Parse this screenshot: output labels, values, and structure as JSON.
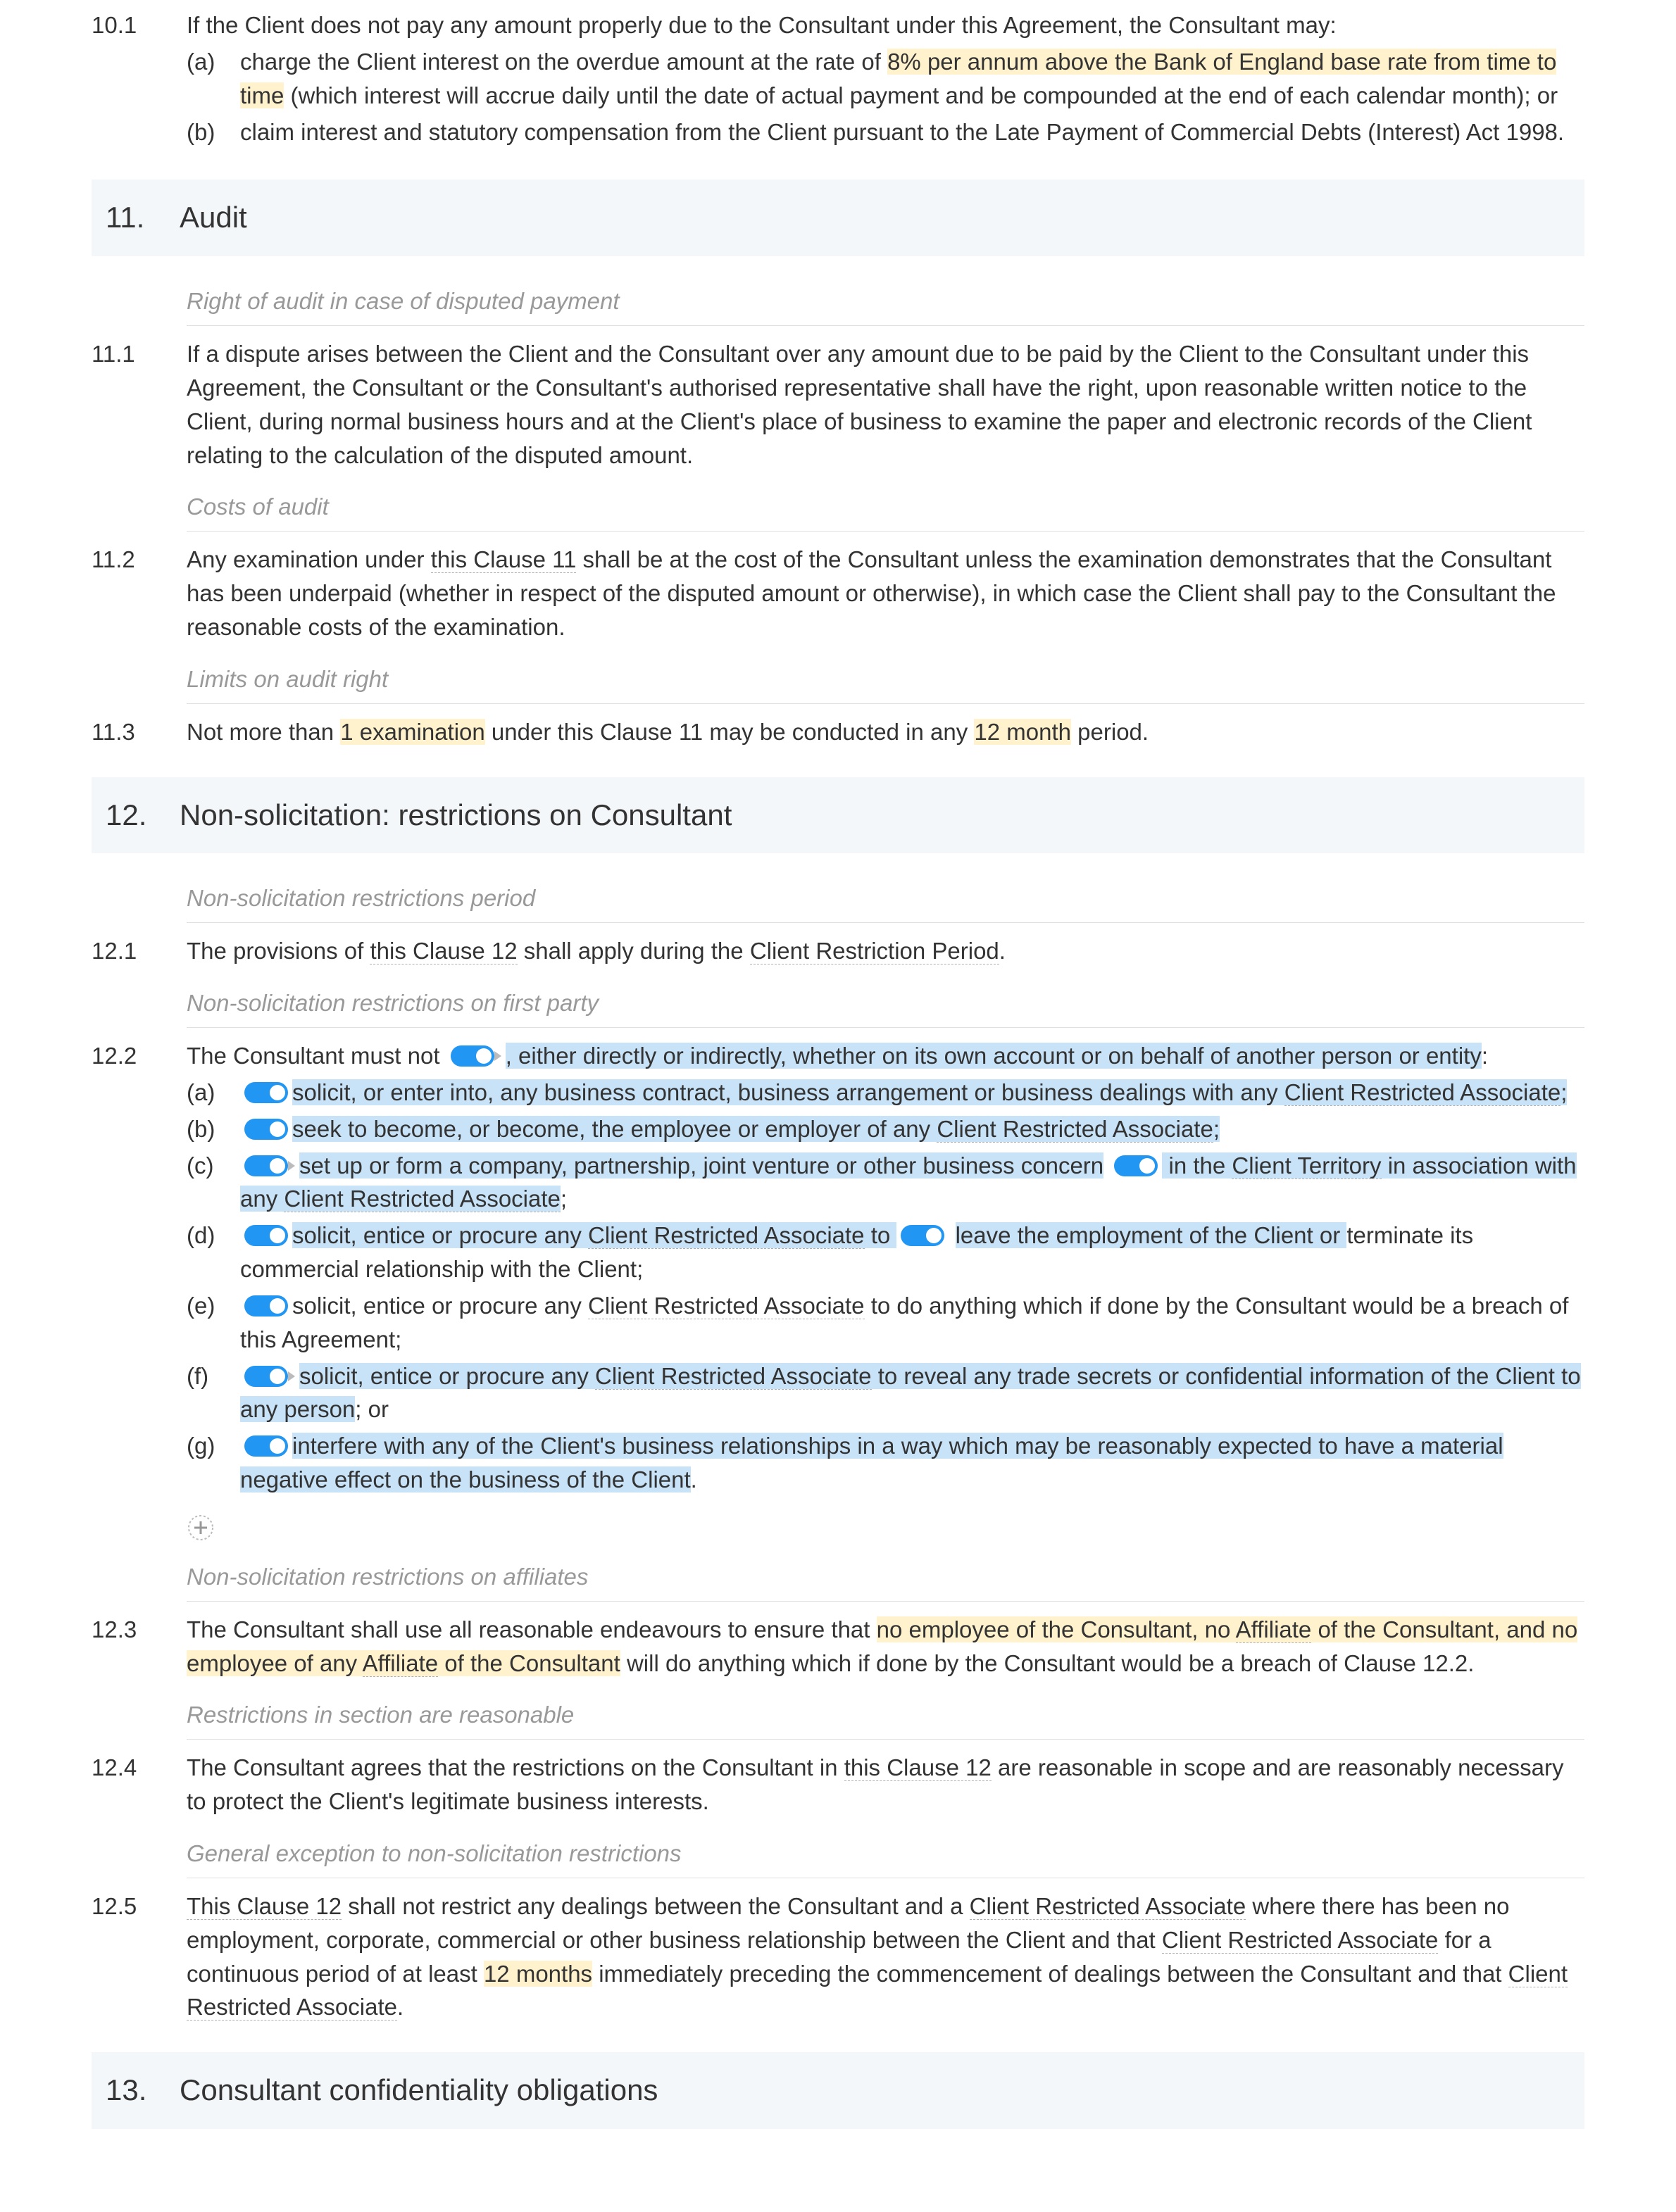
{
  "c10_1": {
    "num": "10.1",
    "text": "If the Client does not pay any amount properly due to the Consultant under this Agreement, the Consultant may:",
    "a_num": "(a)",
    "a_pre": "charge the Client interest on the overdue amount at the rate of ",
    "a_hl": "8% per annum above the Bank of England base rate from time to time",
    "a_post": " (which interest will accrue daily until the date of actual payment and be compounded at the end of each calendar month); or",
    "b_num": "(b)",
    "b_text": "claim interest and statutory compensation from the Client pursuant to the Late Payment of Commercial Debts (Interest) Act 1998."
  },
  "s11": {
    "num": "11.",
    "title": "Audit"
  },
  "sh_11a": "Right of audit in case of disputed payment",
  "c11_1": {
    "num": "11.1",
    "text": "If a dispute arises between the Client and the Consultant over any amount due to be paid by the Client to the Consultant under this Agreement, the Consultant or the Consultant's authorised representative shall have the right, upon reasonable written notice to the Client, during normal business hours and at the Client's place of business to examine the paper and electronic records of the Client relating to the calculation of the disputed amount."
  },
  "sh_11b": "Costs of audit",
  "c11_2": {
    "num": "11.2",
    "pre": "Any examination under ",
    "ref": "this Clause 11",
    "post": " shall be at the cost of the Consultant unless the examination demonstrates that the Consultant has been underpaid (whether in respect of the disputed amount or otherwise), in which case the Client shall pay to the Consultant the reasonable costs of the examination."
  },
  "sh_11c": "Limits on audit right",
  "c11_3": {
    "num": "11.3",
    "p1": "Not more than ",
    "hl1": "1 examination",
    "p2": " under this Clause 11 may be conducted in any ",
    "hl2": "12 month",
    "p3": " period."
  },
  "s12": {
    "num": "12.",
    "title": "Non-solicitation: restrictions on Consultant"
  },
  "sh_12a": "Non-solicitation restrictions period",
  "c12_1": {
    "num": "12.1",
    "p1": "The provisions of ",
    "ref1": "this Clause 12",
    "p2": " shall apply during the ",
    "ref2": "Client Restriction Period",
    "p3": "."
  },
  "sh_12b": "Non-solicitation restrictions on first party",
  "c12_2": {
    "num": "12.2",
    "lead_pre": "The Consultant must not ",
    "lead_hl": ", either directly or indirectly, whether on its own account or on behalf of another person or entity",
    "lead_post": ":",
    "a_num": "(a)",
    "a_hl_pre": "solicit, or enter into, any business contract, business arrangement or business dealings with any ",
    "a_ref": "Client Restricted Associate",
    "a_hl_post": ";",
    "b_num": "(b)",
    "b_hl_pre": "seek to become, or become, the employee or employer of any ",
    "b_ref": "Client Restricted Associate",
    "b_hl_post": ";",
    "c_num": "(c)",
    "c_hl1": "set up or form a company, partnership, joint venture or other business concern",
    "c_hl2_pre": " in the ",
    "c_ref1": "Client Territory",
    "c_hl2_post": " in association with any ",
    "c_ref2": "Client Restricted Associate",
    "c_end": ";",
    "d_num": "(d)",
    "d_hl1_pre": "solicit, entice or procure any ",
    "d_ref": "Client Restricted Associate",
    "d_hl1_post": " to ",
    "d_hl2": "leave the employment of the Client or ",
    "d_post": "terminate its commercial relationship with the Client;",
    "e_num": "(e)",
    "e_pre": "solicit, entice or procure any ",
    "e_ref": "Client Restricted Associate",
    "e_post": " to do anything which if done by the Consultant would be a breach of this Agreement;",
    "f_num": "(f)",
    "f_hl_pre": "solicit, entice or procure any ",
    "f_ref": "Client Restricted Associate",
    "f_hl_post": " to reveal any trade secrets or confidential information of the Client to any person",
    "f_end": "; or",
    "g_num": "(g)",
    "g_hl": "interfere with any of the Client's business relationships in a way which may be reasonably expected to have a material negative effect on the business of the Client",
    "g_end": "."
  },
  "sh_12c": "Non-solicitation restrictions on affiliates",
  "c12_3": {
    "num": "12.3",
    "p1": "The Consultant shall use all reasonable endeavours to ensure that ",
    "hl_pre": "no employee of the Consultant, no ",
    "ref1": "Affiliate",
    "hl_mid": " of the Consultant, and no employee of any ",
    "ref2": "Affiliate",
    "hl_post": " of the Consultant",
    "p2": " will do anything which if done by the Consultant would be a breach of Clause 12.2."
  },
  "sh_12d": "Restrictions in section are reasonable",
  "c12_4": {
    "num": "12.4",
    "p1": "The Consultant agrees that the restrictions on the Consultant in ",
    "ref": "this Clause 12",
    "p2": " are reasonable in scope and are reasonably necessary to protect the Client's legitimate business interests."
  },
  "sh_12e": "General exception to non-solicitation restrictions",
  "c12_5": {
    "num": "12.5",
    "p1": "This Clause 12",
    "p2": " shall not restrict any dealings between the Consultant and a ",
    "ref1": "Client Restricted Associate",
    "p3": " where there has been no employment, corporate, commercial or other business relationship between the Client and that ",
    "ref2": "Client Restricted Associate",
    "p4": " for a continuous period of at least ",
    "hl": "12 months",
    "p5": " immediately preceding the commencement of dealings between the Consultant and that ",
    "ref3": "Client Restricted Associate",
    "p6": "."
  },
  "s13": {
    "num": "13.",
    "title": "Consultant confidentiality obligations"
  }
}
